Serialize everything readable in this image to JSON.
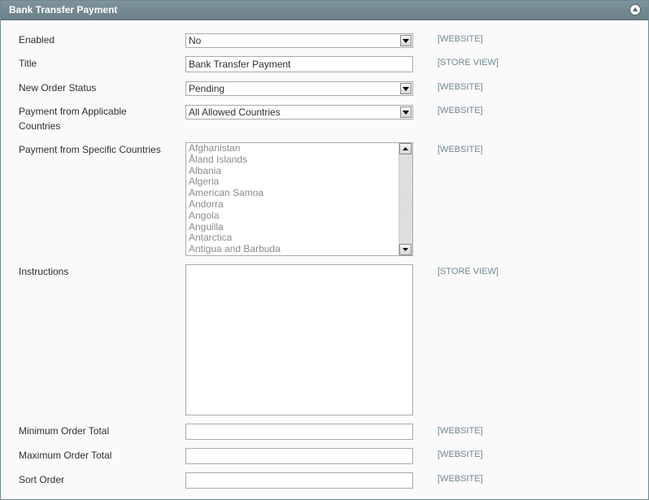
{
  "panel": {
    "title": "Bank Transfer Payment",
    "collapse_icon": "collapse-arrow-up-icon"
  },
  "fields": {
    "enabled": {
      "label": "Enabled",
      "value": "No",
      "scope": "[WEBSITE]"
    },
    "title": {
      "label": "Title",
      "value": "Bank Transfer Payment",
      "scope": "[STORE VIEW]"
    },
    "new_order_status": {
      "label": "New Order Status",
      "value": "Pending",
      "scope": "[WEBSITE]"
    },
    "applicable_countries": {
      "label_line1": "Payment from Applicable",
      "label_line2": "Countries",
      "value": "All Allowed Countries",
      "scope": "[WEBSITE]"
    },
    "specific_countries": {
      "label": "Payment from Specific Countries",
      "scope": "[WEBSITE]",
      "options": [
        "Afghanistan",
        "Åland Islands",
        "Albania",
        "Algeria",
        "American Samoa",
        "Andorra",
        "Angola",
        "Anguilla",
        "Antarctica",
        "Antigua and Barbuda"
      ]
    },
    "instructions": {
      "label": "Instructions",
      "value": "",
      "scope": "[STORE VIEW]"
    },
    "min_order_total": {
      "label": "Minimum Order Total",
      "value": "",
      "scope": "[WEBSITE]"
    },
    "max_order_total": {
      "label": "Maximum Order Total",
      "value": "",
      "scope": "[WEBSITE]"
    },
    "sort_order": {
      "label": "Sort Order",
      "value": "",
      "scope": "[WEBSITE]"
    }
  },
  "icons": {
    "dropdown": "chevron-down-icon",
    "scroll_up": "scroll-up-arrow-icon",
    "scroll_down": "scroll-down-arrow-icon"
  },
  "colors": {
    "header": "#7e939b",
    "scope_text": "#6f8992",
    "border": "#aaaaaa"
  }
}
